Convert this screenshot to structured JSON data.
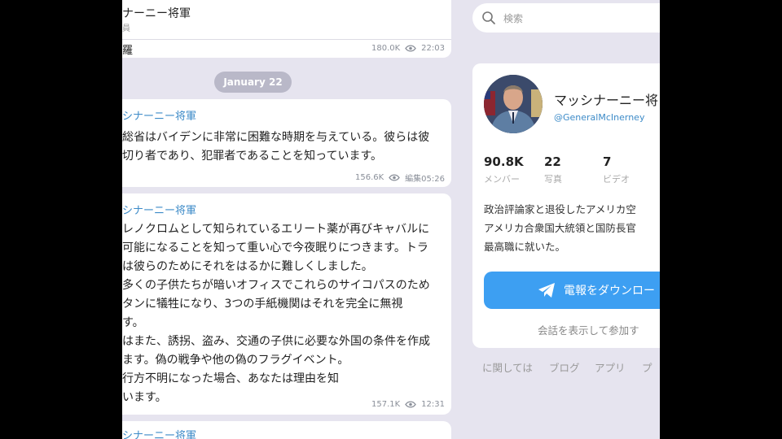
{
  "channel": {
    "name": "ナーニー将軍",
    "subtitle": "員"
  },
  "feed": {
    "top_message": {
      "text_fragment": "羅",
      "views": "180.0K",
      "time": "22:03"
    },
    "date_chip": "January 22",
    "messages": [
      {
        "author": "シナーニー将軍",
        "lines": [
          "総省はバイデンに非常に困難な時期を与えている。彼らは彼",
          "切り者であり、犯罪者であることを知っています。"
        ],
        "views": "156.6K",
        "time": "編集05:26"
      },
      {
        "author": "シナーニー将軍",
        "lines": [
          "レノクロムとして知られているエリート薬が再びキャバルに",
          "可能になることを知って重い心で今夜眠りにつきます。トラ",
          "は彼らのためにそれをはるかに難しくしました。",
          "多くの子供たちが暗いオフィスでこれらのサイコパスのため",
          "タンに犠牲になり、3つの手紙機関はそれを完全に無視",
          "す。",
          "はまた、誘拐、盗み、交通の子供に必要な外国の条件を作成",
          "ます。偽の戦争や他の偽のフラグイベント。",
          "行方不明になった場合、あなたは理由を知",
          "います。"
        ],
        "views": "157.1K",
        "time": "12:31"
      },
      {
        "author": "シナーニー将軍"
      }
    ]
  },
  "search": {
    "placeholder": "検索"
  },
  "profile": {
    "name": "マッシナーニー将",
    "handle": "@GeneralMcInerney",
    "stats": [
      {
        "value": "90.8K",
        "label": "メンバー"
      },
      {
        "value": "22",
        "label": "写真"
      },
      {
        "value": "7",
        "label": "ビデオ"
      }
    ],
    "bio": [
      "政治評論家と退役したアメリカ空",
      "アメリカ合衆国大統領と国防長官",
      "最高職に就いた。"
    ],
    "download_button": "電報をダウンロー",
    "join_text": "会話を表示して参加す"
  },
  "footer": {
    "links": [
      "に関しては",
      "ブログ",
      "アプリ",
      "プ"
    ]
  },
  "colors": {
    "accent": "#3d9ff2",
    "link": "#3d8bc8",
    "background": "#e6e4ef"
  }
}
